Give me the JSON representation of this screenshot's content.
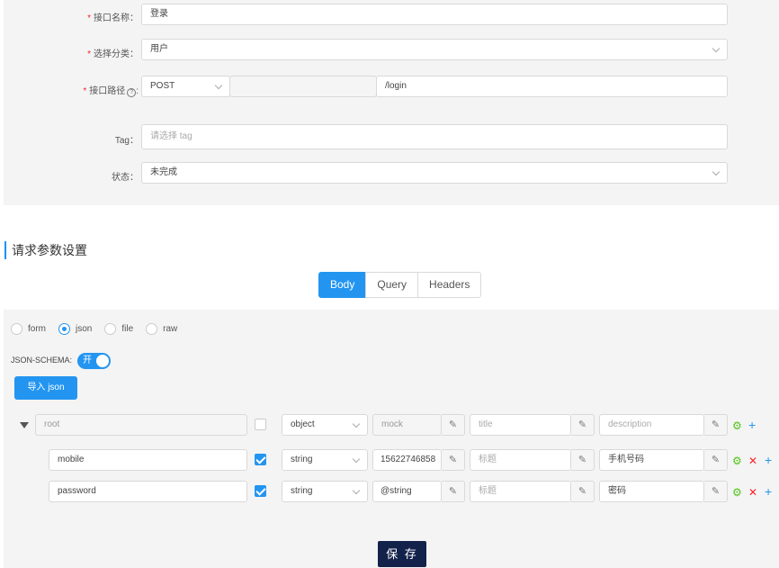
{
  "form": {
    "name_label": "接口名称：",
    "name_value": "登录",
    "category_label": "选择分类：",
    "category_value": "用户",
    "path_label": "接口路径",
    "path_label_colon": ":",
    "method_value": "POST",
    "path_prefix": "",
    "path_value": "/login",
    "tag_label": "Tag：",
    "tag_placeholder": "请选择 tag",
    "status_label": "状态：",
    "status_value": "未完成"
  },
  "section": {
    "title": "请求参数设置"
  },
  "tabs": [
    {
      "label": "Body",
      "active": true
    },
    {
      "label": "Query",
      "active": false
    },
    {
      "label": "Headers",
      "active": false
    }
  ],
  "body_types": [
    {
      "label": "form",
      "selected": false
    },
    {
      "label": "json",
      "selected": true
    },
    {
      "label": "file",
      "selected": false
    },
    {
      "label": "raw",
      "selected": false
    }
  ],
  "schema": {
    "label": "JSON-SCHEMA:",
    "switch_text": "开",
    "switch_on": true
  },
  "import_button": "导入 json",
  "rows": [
    {
      "name": "root",
      "required": false,
      "type": "object",
      "mock": "mock",
      "title": "title",
      "description": "description"
    },
    {
      "name": "mobile",
      "required": true,
      "type": "string",
      "mock": "15622746858",
      "title": "标题",
      "description": "手机号码"
    },
    {
      "name": "password",
      "required": true,
      "type": "string",
      "mock": "@string",
      "title": "标题",
      "description": "密码"
    }
  ],
  "save_button": "保 存",
  "colors": {
    "primary": "#2395f1",
    "save": "#13224b",
    "required_mark": "#f5222d"
  }
}
